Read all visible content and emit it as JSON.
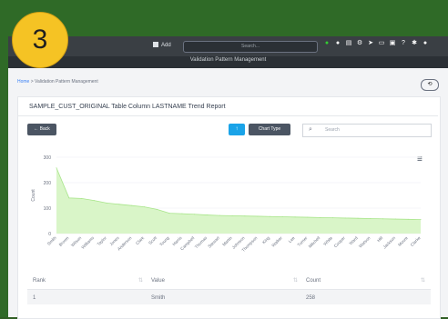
{
  "badge": "3",
  "nav": {
    "add_label": "Add",
    "search_placeholder": "Search...",
    "icons": [
      "leaf-icon",
      "circle-icon",
      "document-icon",
      "gear-icon",
      "send-icon",
      "monitor-icon",
      "message-icon",
      "help-icon",
      "settings-icon",
      "user-icon"
    ]
  },
  "page": {
    "header_title": "Validation Pattern Management",
    "breadcrumb": {
      "home": "Home",
      "sep": ">",
      "current": "Validation Pattern Management"
    },
    "report_title": "SAMPLE_CUST_ORIGINAL Table Column LASTNAME Trend Report"
  },
  "toolbar": {
    "back_label": "← Back",
    "pin_label": "↑",
    "chart_type_label": "Chart Type",
    "search_placeholder": "Search",
    "search_icon": "search-icon"
  },
  "chart_data": {
    "type": "area",
    "categories": [
      "Smith",
      "Brown",
      "Wilson",
      "Williams",
      "Taylor",
      "Jones",
      "Anderson",
      "Clark",
      "Scott",
      "Young",
      "Harris",
      "Campbell",
      "Thomas",
      "Stewart",
      "Martin",
      "Johnson",
      "Thompson",
      "King",
      "Walker",
      "Lee",
      "Turner",
      "Mitchell",
      "White",
      "Cooper",
      "Ward",
      "Watson",
      "Hill",
      "Jackson",
      "Moore",
      "Clarke"
    ],
    "values": [
      258,
      140,
      138,
      130,
      120,
      115,
      110,
      105,
      95,
      80,
      78,
      76,
      73,
      71,
      70,
      69,
      68,
      67,
      66,
      65,
      64,
      63,
      62,
      61,
      60,
      59,
      58,
      57,
      56,
      55
    ],
    "ylabel": "Count",
    "ylim": [
      0,
      300
    ],
    "yticks": [
      0,
      100,
      200,
      300
    ],
    "fill_color": "#d9f5c8",
    "line_color": "#a8e58a",
    "grid": true
  },
  "table": {
    "headers": [
      "Rank",
      "Value",
      "Count"
    ],
    "rows": [
      [
        "1",
        "Smith",
        "258"
      ]
    ]
  }
}
